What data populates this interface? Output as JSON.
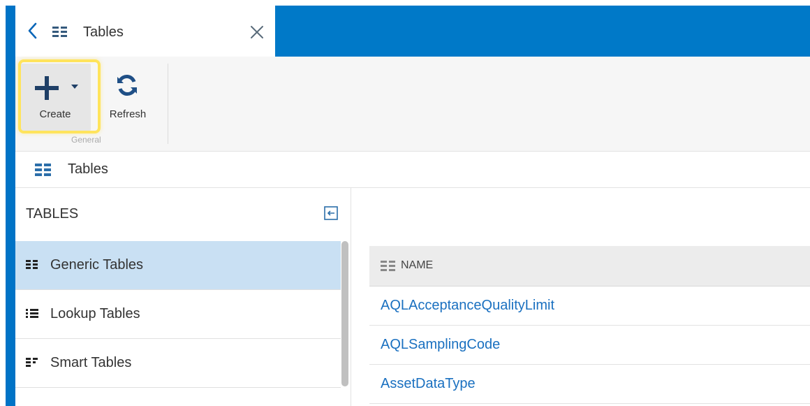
{
  "tab": {
    "title": "Tables"
  },
  "toolbar": {
    "create_label": "Create",
    "refresh_label": "Refresh",
    "group_label": "General"
  },
  "breadcrumb": {
    "title": "Tables"
  },
  "left_panel": {
    "header": "TABLES",
    "items": [
      {
        "label": "Generic Tables",
        "icon": "grid-icon",
        "selected": true
      },
      {
        "label": "Lookup Tables",
        "icon": "list-icon",
        "selected": false
      },
      {
        "label": "Smart Tables",
        "icon": "smart-table-icon",
        "selected": false
      }
    ]
  },
  "grid": {
    "column_header": "NAME",
    "rows": [
      "AQLAcceptanceQualityLimit",
      "AQLSamplingCode",
      "AssetDataType"
    ]
  },
  "colors": {
    "brand_blue": "#0079c8",
    "selected_row": "#c9e0f3",
    "highlight": "#ffe45c",
    "link": "#1a70c0"
  }
}
